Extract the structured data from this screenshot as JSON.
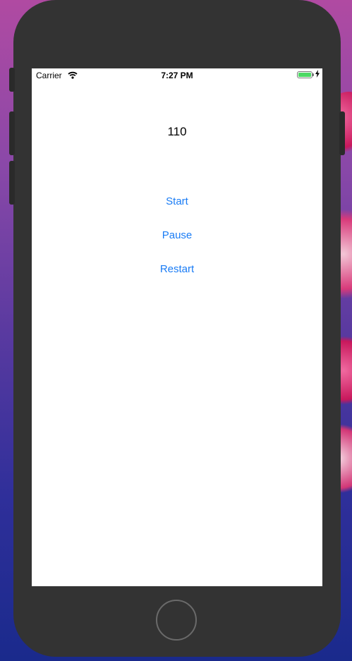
{
  "status_bar": {
    "carrier": "Carrier",
    "time": "7:27 PM",
    "battery_level": 1.0,
    "charging": true
  },
  "icons": {
    "wifi": "wifi-icon",
    "battery": "battery-icon",
    "charging": "charging-bolt-icon"
  },
  "app": {
    "counter_value": "110",
    "start_label": "Start",
    "pause_label": "Pause",
    "restart_label": "Restart"
  },
  "colors": {
    "accent": "#1a7cf5",
    "phone_body": "#333333",
    "battery_fill": "#4cd964"
  }
}
